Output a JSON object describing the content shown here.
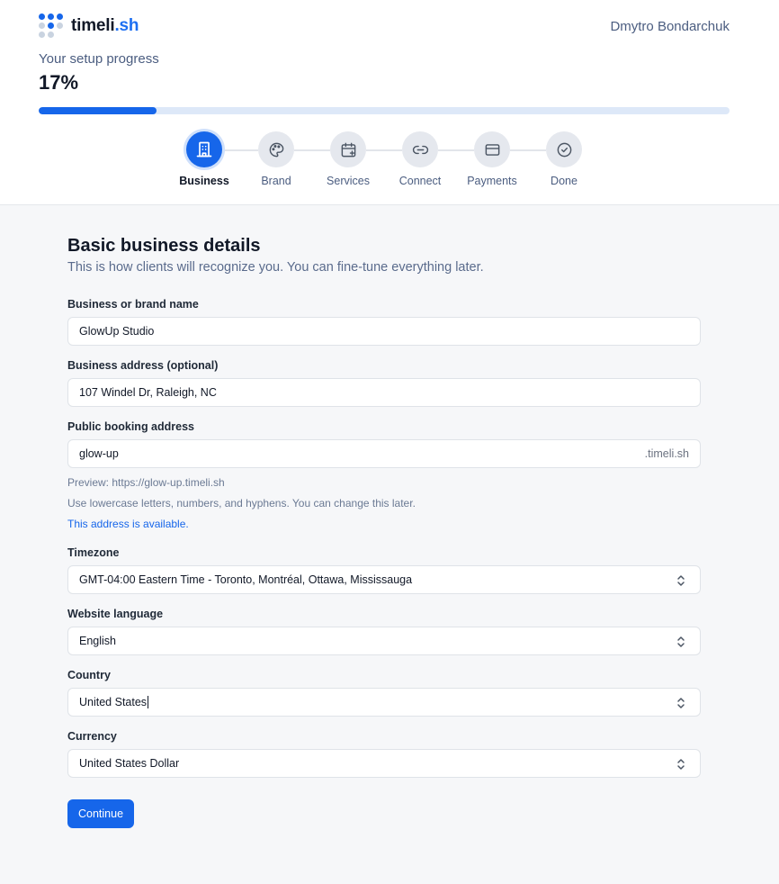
{
  "brand": {
    "name_main": "timeli",
    "name_accent": ".sh"
  },
  "user": {
    "name": "Dmytro Bondarchuk"
  },
  "progress": {
    "label": "Your setup progress",
    "value_text": "17%",
    "fraction": 0.17
  },
  "steps": [
    {
      "label": "Business",
      "icon": "building-icon",
      "active": true
    },
    {
      "label": "Brand",
      "icon": "palette-icon",
      "active": false
    },
    {
      "label": "Services",
      "icon": "calendar-plus-icon",
      "active": false
    },
    {
      "label": "Connect",
      "icon": "link-icon",
      "active": false
    },
    {
      "label": "Payments",
      "icon": "credit-card-icon",
      "active": false
    },
    {
      "label": "Done",
      "icon": "check-circle-icon",
      "active": false
    }
  ],
  "form": {
    "title": "Basic business details",
    "subtitle": "This is how clients will recognize you. You can fine-tune everything later.",
    "business_name": {
      "label": "Business or brand name",
      "value": "GlowUp Studio"
    },
    "business_address": {
      "label": "Business address (optional)",
      "value": "107 Windel Dr, Raleigh, NC"
    },
    "booking_address": {
      "label": "Public booking address",
      "value": "glow-up",
      "suffix": ".timeli.sh",
      "preview": "Preview: https://glow-up.timeli.sh",
      "hint": "Use lowercase letters, numbers, and hyphens. You can change this later.",
      "status": "This address is available."
    },
    "timezone": {
      "label": "Timezone",
      "value": "GMT-04:00 Eastern Time - Toronto, Montréal, Ottawa, Mississauga"
    },
    "language": {
      "label": "Website language",
      "value": "English"
    },
    "country": {
      "label": "Country",
      "value": "United States"
    },
    "currency": {
      "label": "Currency",
      "value": "United States Dollar"
    },
    "continue_label": "Continue"
  },
  "colors": {
    "accent": "#1666ea",
    "track": "#dde8f8",
    "muted_text": "#4b5d80"
  }
}
